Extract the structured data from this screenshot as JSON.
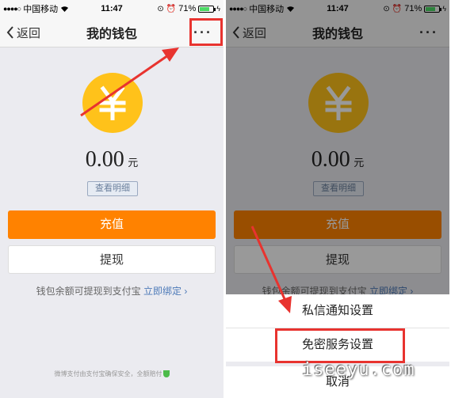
{
  "status_bar": {
    "signal": "●●●●○",
    "carrier": "中国移动",
    "time": "11:47",
    "battery": "71%"
  },
  "nav": {
    "back_label": "返回",
    "title": "我的钱包",
    "more_label": "···"
  },
  "wallet": {
    "amount": "0.00",
    "unit": "元",
    "detail_label": "查看明细",
    "recharge_label": "充值",
    "withdraw_label": "提现",
    "hint_text": "钱包余额可提现到支付宝",
    "bind_link": "立即绑定 ›",
    "footer_note": "微博支付由支付宝确保安全，全额赔付"
  },
  "action_sheet": {
    "items": [
      "私信通知设置",
      "免密服务设置"
    ],
    "cancel_label": "取消"
  },
  "watermark": "iseeyu.com",
  "colors": {
    "accent_orange": "#ff8200",
    "coin_yellow": "#ffc21a",
    "highlight_red": "#e8332f",
    "link_blue": "#4d7ab8"
  }
}
